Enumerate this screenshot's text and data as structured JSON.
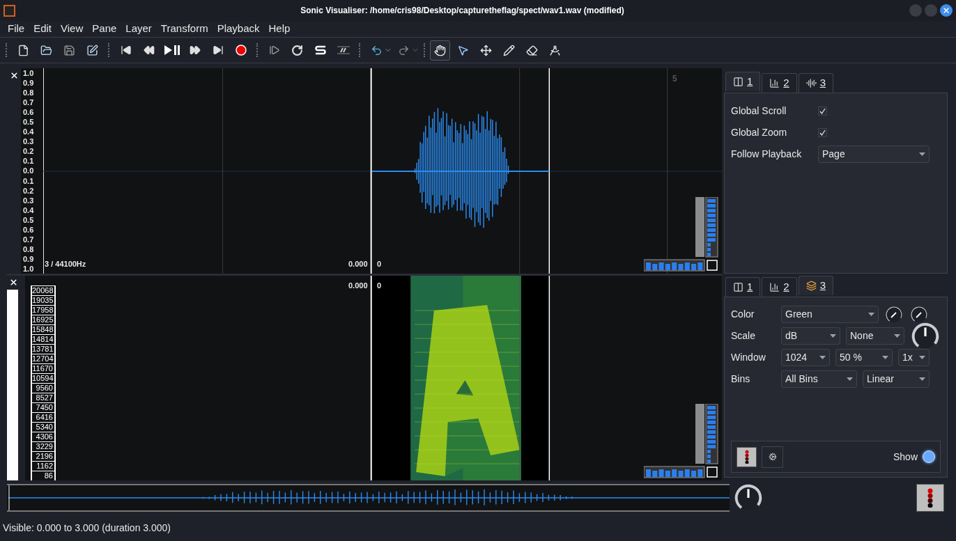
{
  "window": {
    "title": "Sonic Visualiser: /home/cris98/Desktop/capturetheflag/spect/wav1.wav (modified)"
  },
  "menu": [
    "File",
    "Edit",
    "View",
    "Pane",
    "Layer",
    "Transform",
    "Playback",
    "Help"
  ],
  "tools": [
    {
      "kind": "navigate",
      "selected": true
    },
    {
      "kind": "select",
      "selected": false
    },
    {
      "kind": "move",
      "selected": false
    },
    {
      "kind": "draw",
      "selected": false
    },
    {
      "kind": "erase",
      "selected": false
    },
    {
      "kind": "measure",
      "selected": false
    }
  ],
  "waveform_pane": {
    "scale_labels": [
      "1.0",
      "0.9",
      "0.8",
      "0.7",
      "0.6",
      "0.5",
      "0.4",
      "0.3",
      "0.2",
      "0.1",
      "0.0",
      "0.1",
      "0.2",
      "0.3",
      "0.4",
      "0.5",
      "0.6",
      "0.7",
      "0.8",
      "0.9",
      "1.0"
    ],
    "rate": "3 / 44100Hz",
    "time": "0.000",
    "frame": "0",
    "marker": "5"
  },
  "spectrogram_pane": {
    "time": "0.000",
    "frame": "0",
    "frequency_labels": [
      "20068",
      "19035",
      "17958",
      "16925",
      "15848",
      "14814",
      "13781",
      "12704",
      "11670",
      "10594",
      "9560",
      "8527",
      "7450",
      "6416",
      "5340",
      "4306",
      "3229",
      "2196",
      "1162",
      "86"
    ]
  },
  "global_panel": {
    "tabs": [
      {
        "label": "1",
        "kind": "panes",
        "selected": true
      },
      {
        "label": "2",
        "kind": "spectrum",
        "selected": false
      },
      {
        "label": "3",
        "kind": "waveform",
        "selected": false
      }
    ],
    "options": [
      {
        "label": "Global Scroll",
        "kind": "checkbox",
        "checked": true
      },
      {
        "label": "Global Zoom",
        "kind": "checkbox",
        "checked": true
      },
      {
        "label": "Follow Playback",
        "kind": "dropdown",
        "value": "Page"
      }
    ]
  },
  "layer_panel": {
    "tabs": [
      {
        "label": "1",
        "kind": "panes",
        "selected": false
      },
      {
        "label": "2",
        "kind": "spectrum",
        "selected": false
      },
      {
        "label": "3",
        "kind": "layer",
        "selected": true
      }
    ],
    "rows": [
      {
        "label": "Color",
        "controls": [
          {
            "kind": "dropdown",
            "value": "Green"
          },
          {
            "kind": "knob"
          },
          {
            "kind": "knob"
          }
        ]
      },
      {
        "label": "Scale",
        "controls": [
          {
            "kind": "dropdown",
            "value": "dB"
          },
          {
            "kind": "dropdown",
            "value": "None"
          },
          {
            "kind": "knob"
          }
        ]
      },
      {
        "label": "Window",
        "controls": [
          {
            "kind": "dropdown",
            "value": "1024"
          },
          {
            "kind": "dropdown",
            "value": "50 %"
          },
          {
            "kind": "dropdown",
            "value": "1x"
          }
        ]
      },
      {
        "label": "Bins",
        "controls": [
          {
            "kind": "dropdown",
            "value": "All Bins"
          },
          {
            "kind": "dropdown",
            "value": "Linear"
          }
        ]
      }
    ],
    "show": {
      "label": "Show",
      "on": true
    }
  },
  "status_bar": "Visible: 0.000 to 3.000 (duration 3.000)"
}
